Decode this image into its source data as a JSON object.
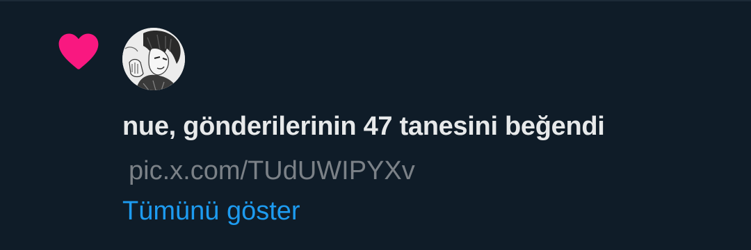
{
  "notification": {
    "type_icon": "heart-icon",
    "heart_color": "#f91880",
    "avatar": "user-avatar-sketch",
    "message": "nue, gönderilerinin 47 tanesini beğendi",
    "link_text": "pic.x.com/TUdUWIPYXv",
    "show_all_label": "Tümünü göster",
    "accent_color": "#1d9bf0"
  }
}
